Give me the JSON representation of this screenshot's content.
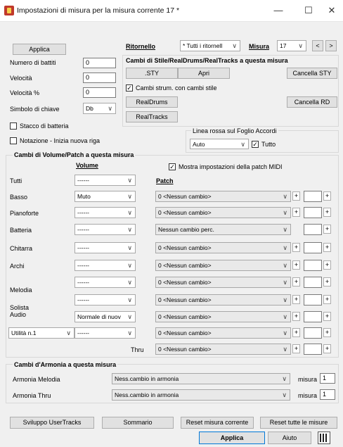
{
  "window": {
    "title": "Impostazioni di misura per la misura corrente 17 *",
    "minimize": "—",
    "maximize": "☐",
    "close": "✕"
  },
  "top": {
    "applica_small": "Applica",
    "numero_battiti_label": "Numero di battiti",
    "numero_battiti_value": "0",
    "velocita_label": "Velocità",
    "velocita_value": "0",
    "velocita_pct_label": "Velocità %",
    "velocita_pct_value": "0",
    "simbolo_label": "Simbolo di chiave",
    "simbolo_value": "Db",
    "stacco_label": "Stacco di batteria",
    "notazione_label": "Notazione - Inizia nuova riga"
  },
  "ritornello": {
    "label": "Ritornello",
    "value": "* Tutti i ritornell",
    "misura_label": "Misura",
    "misura_value": "17",
    "prev": "<",
    "next": ">"
  },
  "style_section": {
    "title": "Cambi di Stile/RealDrums/RealTracks a questa misura",
    "sty_button": ".STY",
    "apri_button": "Apri",
    "cancella_sty": "Cancella STY",
    "cambi_strum_label": "Cambi strum. con cambi stile",
    "realdrums_button": "RealDrums",
    "cancella_rd": "Cancella RD",
    "realtracks_button": "RealTracks"
  },
  "linea_rossa": {
    "label": "Linea rossa sul Foglio Accordi",
    "value": "Auto",
    "tutto_label": "Tutto"
  },
  "volume_section": {
    "title": "Cambi di Volume/Patch a questa misura",
    "volume_header": "Volume",
    "mostra_label": "Mostra impostazioni della patch MIDI",
    "patch_header": "Patch",
    "rows": [
      {
        "name": "Tutti",
        "volume": "------"
      },
      {
        "name": "Basso",
        "volume": "Muto",
        "patch": "0 <Nessun cambio>"
      },
      {
        "name": "Pianoforte",
        "volume": "------",
        "patch": "0 <Nessun cambio>"
      },
      {
        "name": "Batteria",
        "volume": "------",
        "patch": "Nessun cambio perc."
      },
      {
        "name": "Chitarra",
        "volume": "------",
        "patch": "0 <Nessun cambio>"
      },
      {
        "name": "Archi",
        "volume": "------",
        "patch": "0 <Nessun cambio>"
      },
      {
        "name": "Melodia",
        "volume": "------",
        "patch": "0 <Nessun cambio>"
      },
      {
        "name": "",
        "volume": "",
        "patch": "0 <Nessun cambio>"
      },
      {
        "name": "Solista\nAudio",
        "volume": "Normale di nuov",
        "patch": "0 <Nessun cambio>"
      },
      {
        "name": "Utilità n.1",
        "volume": "------",
        "patch": "0 <Nessun cambio>"
      },
      {
        "name": "Thru",
        "patch": "0 <Nessun cambio>"
      }
    ]
  },
  "armonia": {
    "title": "Cambi d'Armonia a questa misura",
    "melodia_label": "Armonia Melodia",
    "melodia_value": "Ness.cambio in armonia",
    "misura1_label": "misura",
    "misura1_value": "1",
    "thru_label": "Armonia Thru",
    "thru_value": "Ness.cambio in armonia",
    "misura2_label": "misura",
    "misura2_value": "1"
  },
  "bottom": {
    "sviluppo": "Sviluppo UserTracks",
    "sommario": "Sommario",
    "reset_corrente": "Reset misura corrente",
    "reset_tutte": "Reset tutte le misure",
    "applica": "Applica",
    "aiuto": "Aiuto"
  },
  "colors": {
    "accent": "#0078d7",
    "applica_bg": "#e1e1e1"
  }
}
